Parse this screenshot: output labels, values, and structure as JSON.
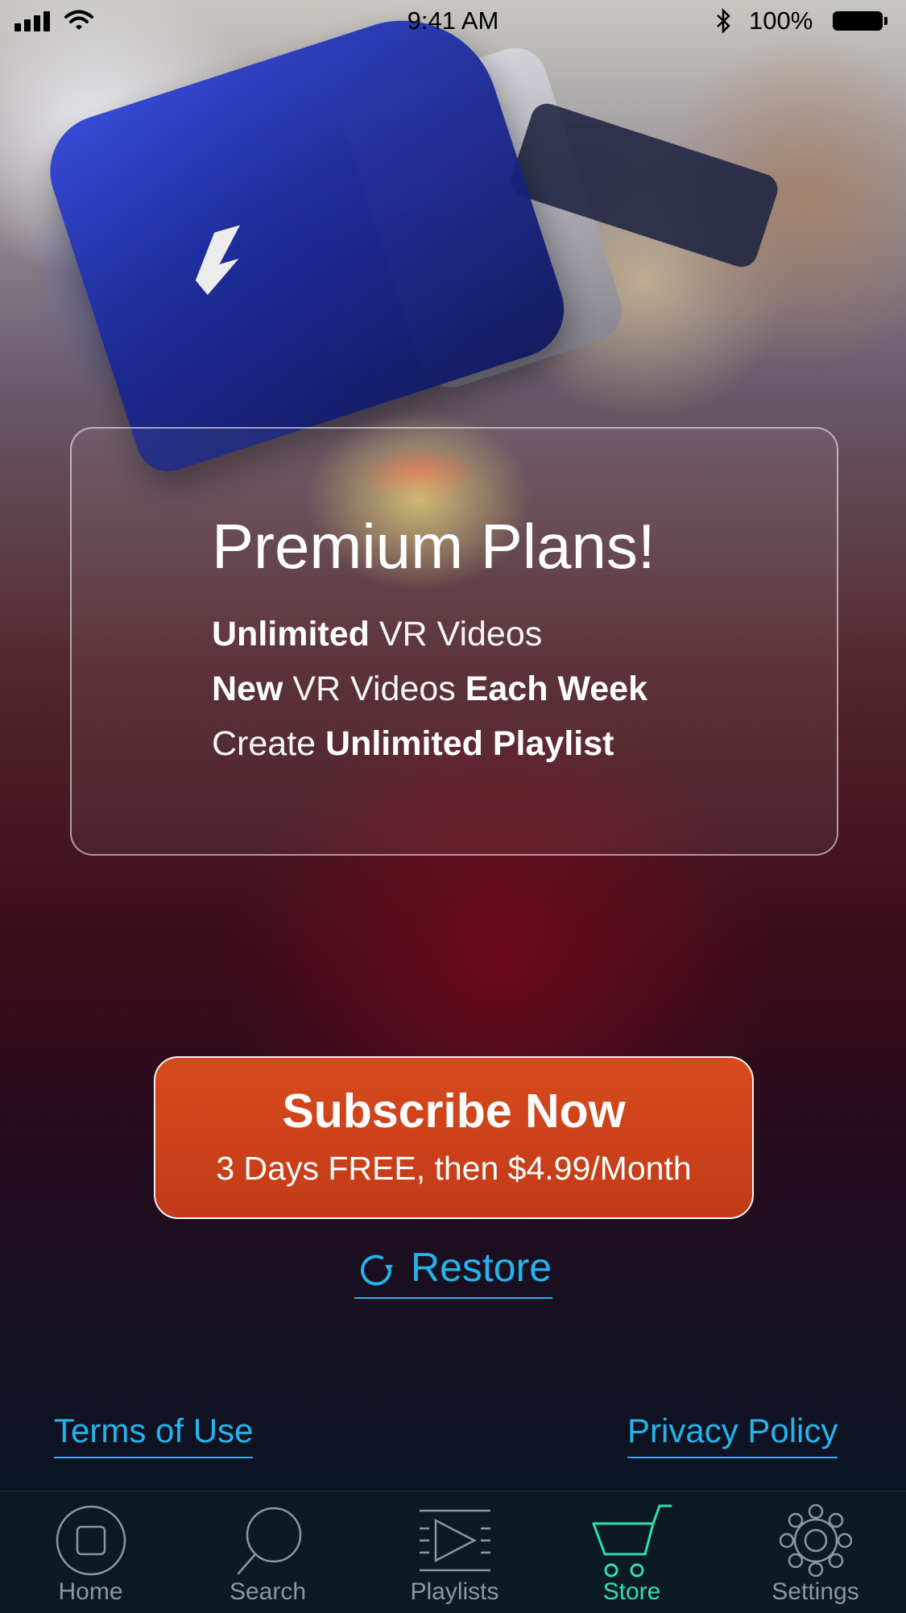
{
  "status_bar": {
    "time": "9:41 AM",
    "battery": "100%"
  },
  "promo": {
    "title": "Premium Plans!",
    "features": [
      {
        "bold": "Unlimited",
        "light": " VR Videos"
      },
      {
        "bold": "New",
        "light": " VR Videos ",
        "bold2": "Each Week"
      },
      {
        "light": "Create ",
        "bold": "Unlimited Playlist"
      }
    ]
  },
  "subscribe": {
    "label": "Subscribe Now",
    "sublabel": "3 Days FREE, then $4.99/Month"
  },
  "restore": {
    "label": "Restore"
  },
  "links": {
    "terms": "Terms of Use",
    "privacy": "Privacy Policy"
  },
  "tabs": [
    {
      "label": "Home",
      "icon": "home-icon"
    },
    {
      "label": "Search",
      "icon": "search-icon"
    },
    {
      "label": "Playlists",
      "icon": "playlists-icon"
    },
    {
      "label": "Store",
      "icon": "cart-icon",
      "active": true
    },
    {
      "label": "Settings",
      "icon": "gear-icon"
    }
  ],
  "colors": {
    "accent": "#25b4ea",
    "active_tab": "#2fe0b0",
    "subscribe_bg": "#c9401a",
    "tabbar_bg": "#0c1a26"
  }
}
